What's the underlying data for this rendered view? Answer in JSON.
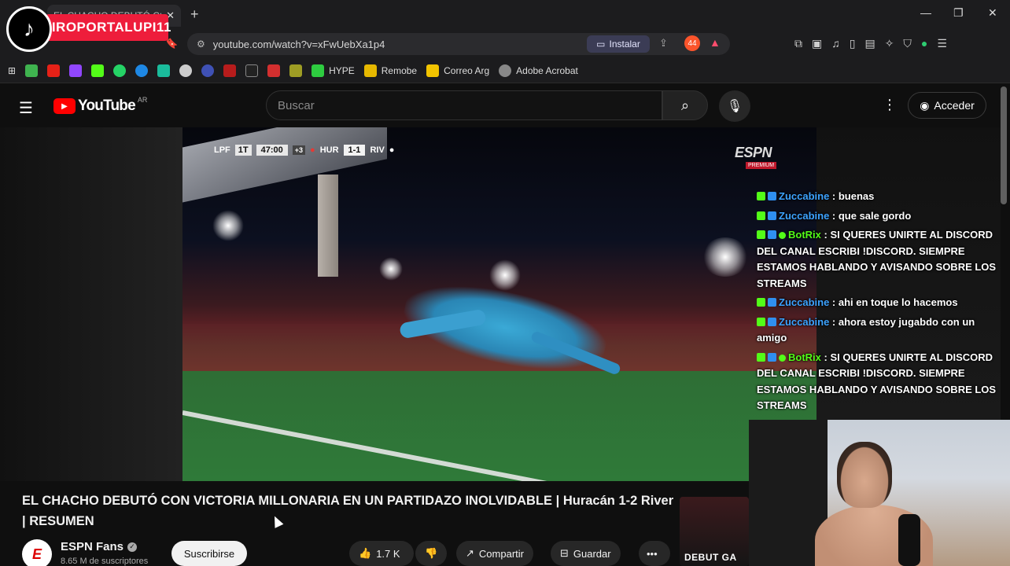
{
  "browser": {
    "tab_title": "EL CHACHO DEBUTÓ CON",
    "url": "youtube.com/watch?v=xFwUebXa1p4",
    "install_label": "Instalar",
    "brave_count": "44",
    "bookmarks": [
      {
        "label": "HYPE",
        "color": "#2ecc40"
      },
      {
        "label": "Remobe",
        "color": "#e6b800"
      },
      {
        "label": "Correo Arg",
        "color": "#f2c400"
      },
      {
        "label": "Adobe Acrobat",
        "color": "#888888"
      }
    ]
  },
  "overlay": {
    "tiktok_handle": "EIROPORTALUPI11"
  },
  "youtube": {
    "logo_text": "YouTube",
    "country_code": "AR",
    "search_placeholder": "Buscar",
    "signin_label": "Acceder"
  },
  "video": {
    "scorebug": {
      "league": "LPF",
      "period": "1T",
      "clock": "47:00",
      "added_time": "+3",
      "home": "HUR",
      "score": "1-1",
      "away": "RIV"
    },
    "broadcaster": "ESPN",
    "broadcaster_sub": "PREMIUM"
  },
  "chat": [
    {
      "user": "Zuccabine",
      "user_class": "u-zucc",
      "badges": [
        "b-green",
        "b-blue"
      ],
      "message": " : buenas"
    },
    {
      "user": "Zuccabine",
      "user_class": "u-zucc",
      "badges": [
        "b-green",
        "b-blue"
      ],
      "message": " : que sale gordo"
    },
    {
      "user": "BotRix",
      "user_class": "u-bot",
      "badges": [
        "b-green",
        "b-blue",
        "b-dot"
      ],
      "message": " : SI QUERES UNIRTE AL DISCORD DEL CANAL ESCRIBI !DISCORD. SIEMPRE ESTAMOS HABLANDO Y AVISANDO SOBRE LOS STREAMS"
    },
    {
      "user": "Zuccabine",
      "user_class": "u-zucc",
      "badges": [
        "b-green",
        "b-blue"
      ],
      "message": " : ahi en toque lo hacemos"
    },
    {
      "user": "Zuccabine",
      "user_class": "u-zucc",
      "badges": [
        "b-green",
        "b-blue"
      ],
      "message": " : ahora estoy jugabdo con un amigo"
    },
    {
      "user": "BotRix",
      "user_class": "u-bot",
      "badges": [
        "b-green",
        "b-blue",
        "b-dot"
      ],
      "message": " : SI QUERES UNIRTE AL DISCORD DEL CANAL ESCRIBI !DISCORD. SIEMPRE ESTAMOS HABLANDO Y AVISANDO SOBRE LOS STREAMS"
    }
  ],
  "info": {
    "title": "EL CHACHO DEBUTÓ CON VICTORIA MILLONARIA EN UN PARTIDAZO INOLVIDABLE | Huracán 1-2 River | RESUMEN",
    "channel_name": "ESPN Fans",
    "subscribers": "8.65 M de suscriptores",
    "subscribe_label": "Suscribirse",
    "likes": "1.7 K",
    "share_label": "Compartir",
    "save_label": "Guardar",
    "promo_text": "DEBUT GA"
  }
}
